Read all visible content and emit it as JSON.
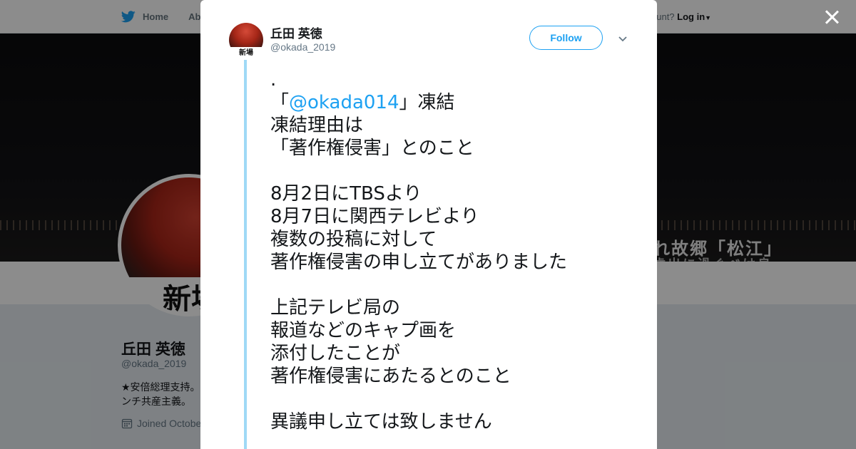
{
  "topbar": {
    "home_label": "Home",
    "about_label": "Abo",
    "account_prompt": "ccount?",
    "login_label": "Log in"
  },
  "banner": {
    "text_line1": "れ故郷「松江」",
    "text_line2": "歳出に過ぐべけ良"
  },
  "profile": {
    "avatar_text": "新場",
    "name": "丘田 英徳",
    "handle": "@okada_2019",
    "bio": "★安倍総理支持。ンチ共産主義。",
    "joined": "Joined Octobe"
  },
  "modal": {
    "name": "丘田 英徳",
    "handle": "@okada_2019",
    "avatar_text": "新場",
    "follow_label": "Follow",
    "tweet": {
      "line_dot": ".",
      "open_bracket": "「",
      "mention": "@okada014",
      "close_text": "」凍結",
      "body": "\n凍結理由は\n「著作権侵害」とのこと\n\n8月2日にTBSより\n8月7日に関西テレビより\n複数の投稿に対して\n著作権侵害の申し立てがありました\n\n上記テレビ局の\n報道などのキャプ画を\n添付したことが\n著作権侵害にあたるとのこと\n\n異議申し立ては致しません"
    }
  },
  "colors": {
    "accent": "#1da1f2",
    "thread_line": "#9fd9f6",
    "text": "#14171a",
    "secondary_text": "#657786"
  }
}
